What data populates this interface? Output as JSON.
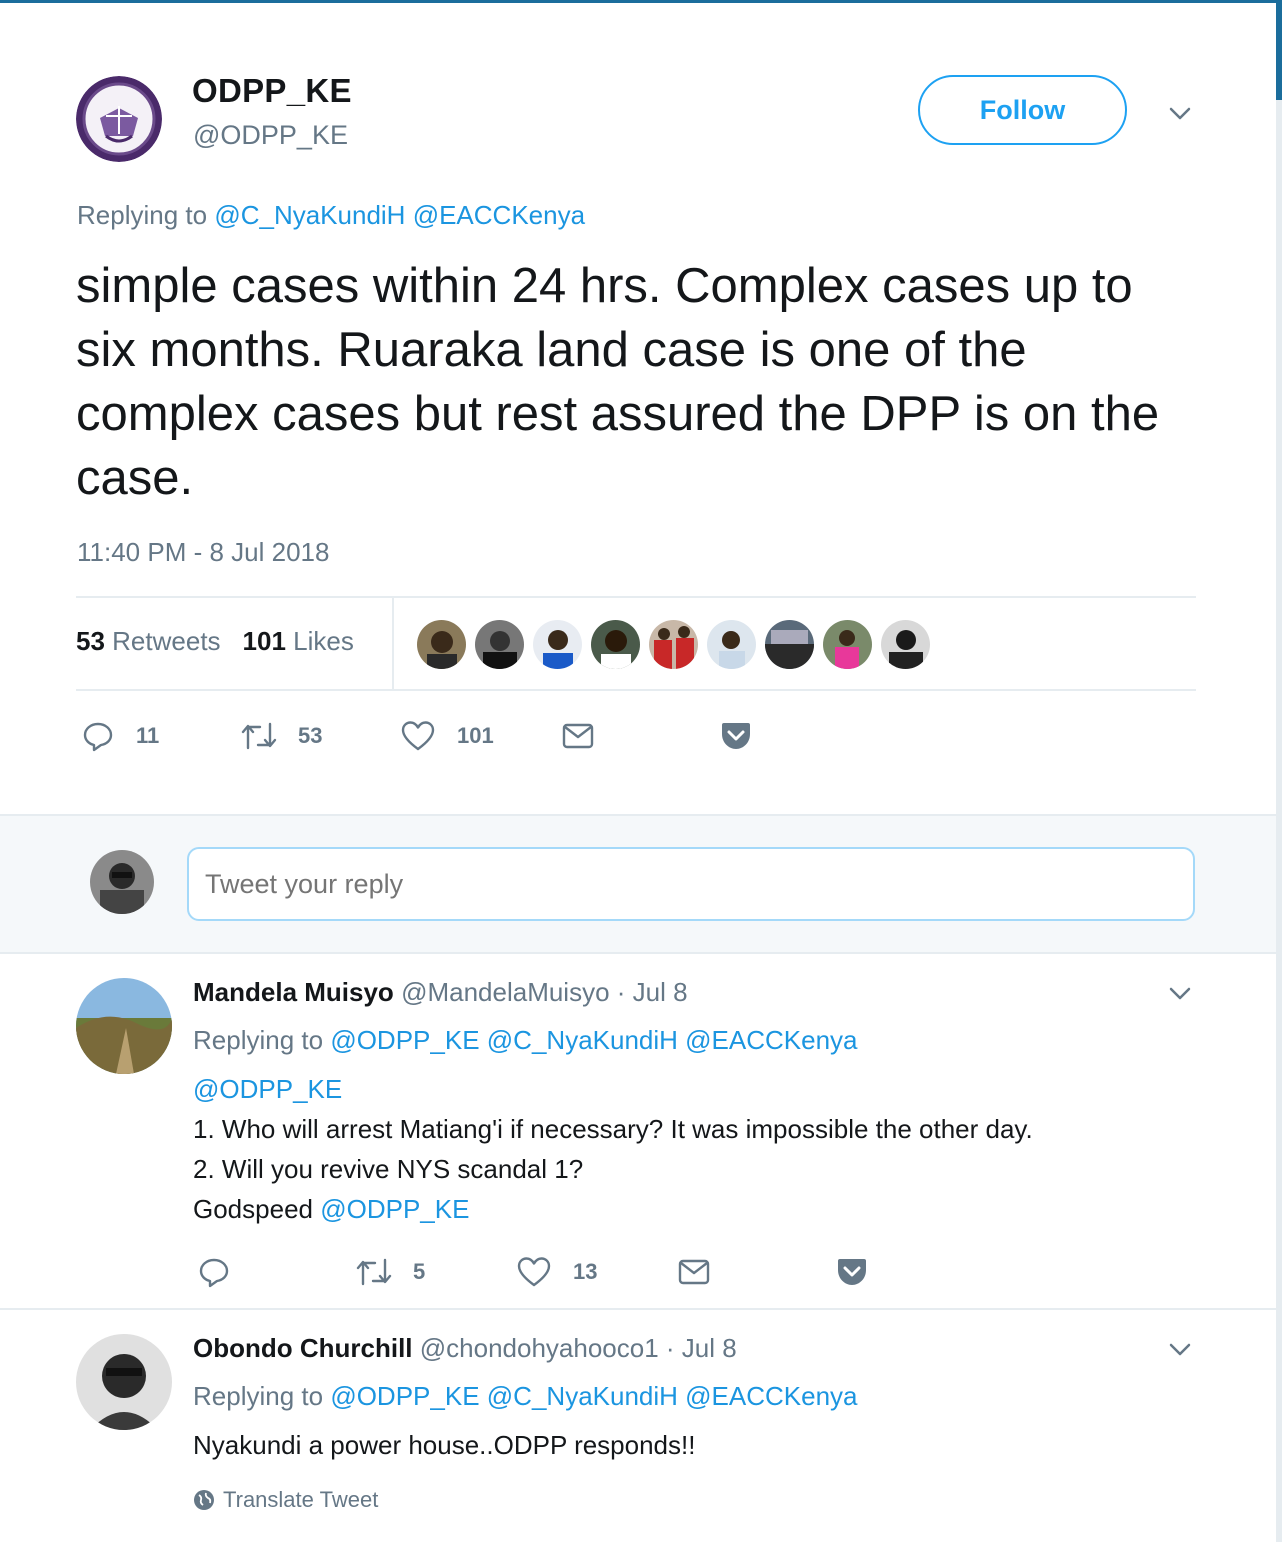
{
  "tweet": {
    "display_name": "ODPP_KE",
    "handle": "@ODPP_KE",
    "follow_label": "Follow",
    "replying_prefix": "Replying to",
    "replying_mentions": [
      "@C_NyaKundiH",
      "@EACCKenya"
    ],
    "text": "simple cases within 24 hrs. Complex cases up to six months. Ruaraka land case is one of the complex cases but rest assured the DPP is on the case.",
    "timestamp": "11:40 PM - 8 Jul 2018",
    "retweets_count": "53",
    "retweets_label": "Retweets",
    "likes_count": "101",
    "likes_label": "Likes",
    "actions": {
      "replies": "11",
      "retweets": "53",
      "likes": "101"
    }
  },
  "reply_box": {
    "placeholder": "Tweet your reply"
  },
  "replies": [
    {
      "name": "Mandela Muisyo",
      "handle": "@MandelaMuisyo",
      "date": "· Jul 8",
      "replying_prefix": "Replying to",
      "replying_mentions": [
        "@ODPP_KE",
        "@C_NyaKundiH",
        "@EACCKenya"
      ],
      "line1_mention": "@ODPP_KE",
      "line2": "1. Who will arrest Matiang'i if necessary? It was impossible the other day.",
      "line3": "2. Will you revive NYS scandal 1?",
      "line4_text": "Godspeed",
      "line4_mention": "@ODPP_KE",
      "actions": {
        "replies": "",
        "retweets": "5",
        "likes": "13"
      }
    },
    {
      "name": "Obondo Churchill",
      "handle": "@chondohyahooco1",
      "date": "· Jul 8",
      "replying_prefix": "Replying to",
      "replying_mentions": [
        "@ODPP_KE",
        "@C_NyaKundiH",
        "@EACCKenya"
      ],
      "text": "Nyakundi a power house..ODPP responds!!",
      "translate_label": "Translate Tweet"
    }
  ],
  "colors": {
    "accent": "#1da1f2",
    "link": "#1b95e0",
    "muted": "#657786",
    "text": "#14171a"
  }
}
